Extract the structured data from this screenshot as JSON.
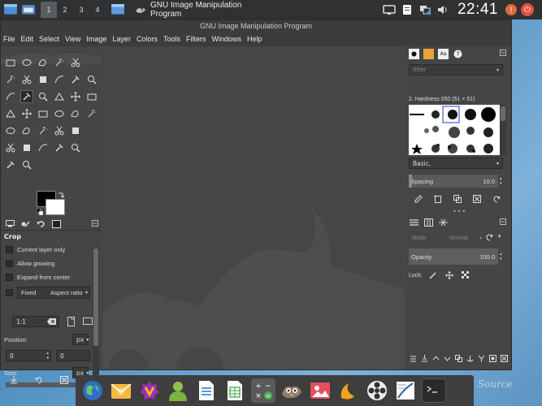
{
  "top_panel": {
    "workspaces": [
      "1",
      "2",
      "3",
      "4"
    ],
    "active_workspace": "1",
    "task_title": "GNU Image Manipulation Program",
    "clock": "22:41"
  },
  "window": {
    "title": "GNU Image Manipulation Program",
    "menus": [
      "File",
      "Edit",
      "Select",
      "View",
      "Image",
      "Layer",
      "Colors",
      "Tools",
      "Filters",
      "Windows",
      "Help"
    ]
  },
  "tool_options": {
    "title": "Crop",
    "current_layer_only": "Current layer only",
    "allow_growing": "Allow growing",
    "expand_from_center": "Expand from center",
    "fixed": "Fixed",
    "fixed_mode": "Aspect ratio",
    "ratio_value": "1:1",
    "position_label": "Position:",
    "position_unit": "px",
    "position_x": "0",
    "position_y": "0",
    "size_label": "Size:",
    "size_unit": "px"
  },
  "brushes": {
    "filter_placeholder": "filter",
    "current_brush": "2. Hardness 050 (51 × 51)",
    "preset": "Basic,",
    "spacing_label": "Spacing",
    "spacing_value": "10.0"
  },
  "layers": {
    "mode_label": "Mode",
    "mode_value": "Normal",
    "opacity_label": "Opacity",
    "opacity_value": "100.0",
    "lock_label": "Lock:"
  },
  "dock_brand": "Source",
  "colors": {
    "panel_bg": "#2f3133",
    "gimp_bg": "#454545",
    "accent_red": "#e2523c"
  }
}
